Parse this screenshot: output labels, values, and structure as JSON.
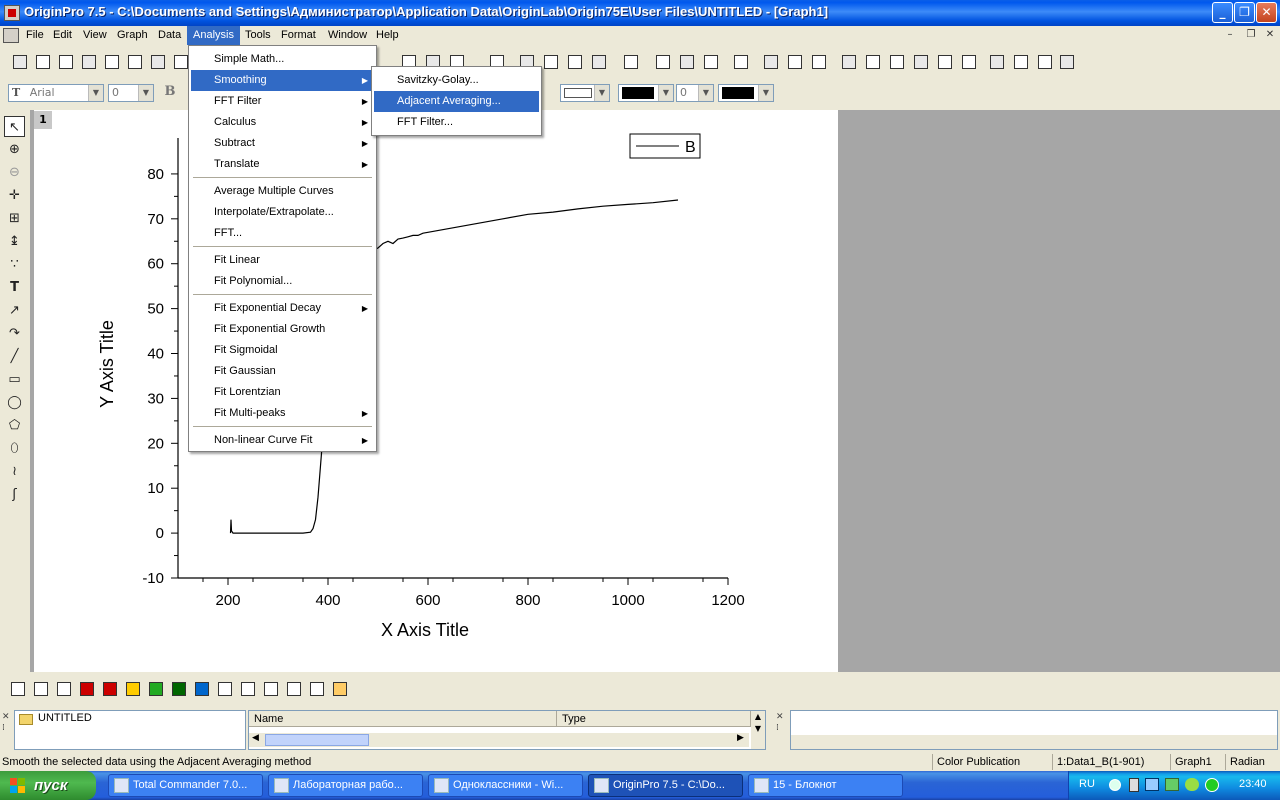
{
  "window": {
    "title": "OriginPro 7.5 - C:\\Documents and Settings\\Администратор\\Application Data\\OriginLab\\Origin75E\\User Files\\UNTITLED - [Graph1]",
    "minimize": "_",
    "restore": "❐",
    "close": "✕"
  },
  "menubar": {
    "items": [
      "File",
      "Edit",
      "View",
      "Graph",
      "Data",
      "Analysis",
      "Tools",
      "Format",
      "Window",
      "Help"
    ],
    "active": "Analysis"
  },
  "format_toolbar": {
    "font": "Arial",
    "size": "0",
    "size2": "0"
  },
  "graph": {
    "layer_number": "1"
  },
  "analysis_menu": {
    "items": [
      {
        "label": "Simple Math...",
        "submenu": false
      },
      {
        "label": "Smoothing",
        "submenu": true
      },
      {
        "label": "FFT Filter",
        "submenu": true
      },
      {
        "label": "Calculus",
        "submenu": true
      },
      {
        "label": "Subtract",
        "submenu": true
      },
      {
        "label": "Translate",
        "submenu": true
      },
      {
        "label": "Average Multiple Curves",
        "submenu": false
      },
      {
        "label": "Interpolate/Extrapolate...",
        "submenu": false
      },
      {
        "label": "FFT...",
        "submenu": false
      },
      {
        "label": "Fit Linear",
        "submenu": false
      },
      {
        "label": "Fit Polynomial...",
        "submenu": false
      },
      {
        "label": "Fit Exponential Decay",
        "submenu": true
      },
      {
        "label": "Fit Exponential Growth",
        "submenu": false
      },
      {
        "label": "Fit Sigmoidal",
        "submenu": false
      },
      {
        "label": "Fit Gaussian",
        "submenu": false
      },
      {
        "label": "Fit Lorentzian",
        "submenu": false
      },
      {
        "label": "Fit Multi-peaks",
        "submenu": true
      },
      {
        "label": "Non-linear Curve Fit",
        "submenu": true
      }
    ],
    "highlighted": "Smoothing"
  },
  "smoothing_menu": {
    "items": [
      "Savitzky-Golay...",
      "Adjacent Averaging...",
      "FFT Filter..."
    ],
    "highlighted": "Adjacent Averaging..."
  },
  "chart_data": {
    "type": "line",
    "xlabel": "X Axis Title",
    "ylabel": "Y Axis Title",
    "xlim": [
      100,
      1200
    ],
    "ylim": [
      -10,
      88
    ],
    "xticks": [
      200,
      400,
      600,
      800,
      1000,
      1200
    ],
    "yticks": [
      -10,
      0,
      10,
      20,
      30,
      40,
      50,
      60,
      70,
      80
    ],
    "legend": "top-right",
    "series": [
      {
        "name": "B",
        "x": [
          205,
          206,
          207,
          210,
          220,
          250,
          300,
          350,
          365,
          370,
          375,
          380,
          385,
          390,
          394,
          396,
          398,
          400,
          450,
          500,
          510,
          520,
          530,
          540,
          550,
          560,
          570,
          580,
          590,
          600,
          650,
          700,
          750,
          800,
          850,
          900,
          950,
          1000,
          1050,
          1100
        ],
        "y": [
          0,
          3,
          0.5,
          0,
          0,
          0,
          0,
          0,
          0.2,
          1,
          3,
          8,
          15,
          22,
          35,
          45,
          55,
          60,
          61,
          63.5,
          64.5,
          65,
          64.5,
          65.5,
          65.7,
          66,
          66.3,
          66.3,
          66.8,
          67,
          68,
          69,
          70,
          71,
          71.5,
          72.2,
          72.8,
          73.2,
          73.6,
          74.2
        ]
      }
    ]
  },
  "explorer": {
    "folder": "UNTITLED",
    "col_name": "Name",
    "col_type": "Type"
  },
  "statusbar": {
    "message": "Smooth the selected data using the Adjacent Averaging method",
    "theme": "Color Publication",
    "active_data": "1:Data1_B(1-901)",
    "window": "Graph1",
    "angle": "Radian"
  },
  "taskbar": {
    "start": "пуск",
    "tasks": [
      "Total Commander 7.0...",
      "Лабораторная рабо...",
      "Одноклассники - Wi...",
      "OriginPro 7.5 - C:\\Do...",
      "15 - Блокнот"
    ],
    "active_task": 3,
    "lang": "RU",
    "clock": "23:40"
  }
}
